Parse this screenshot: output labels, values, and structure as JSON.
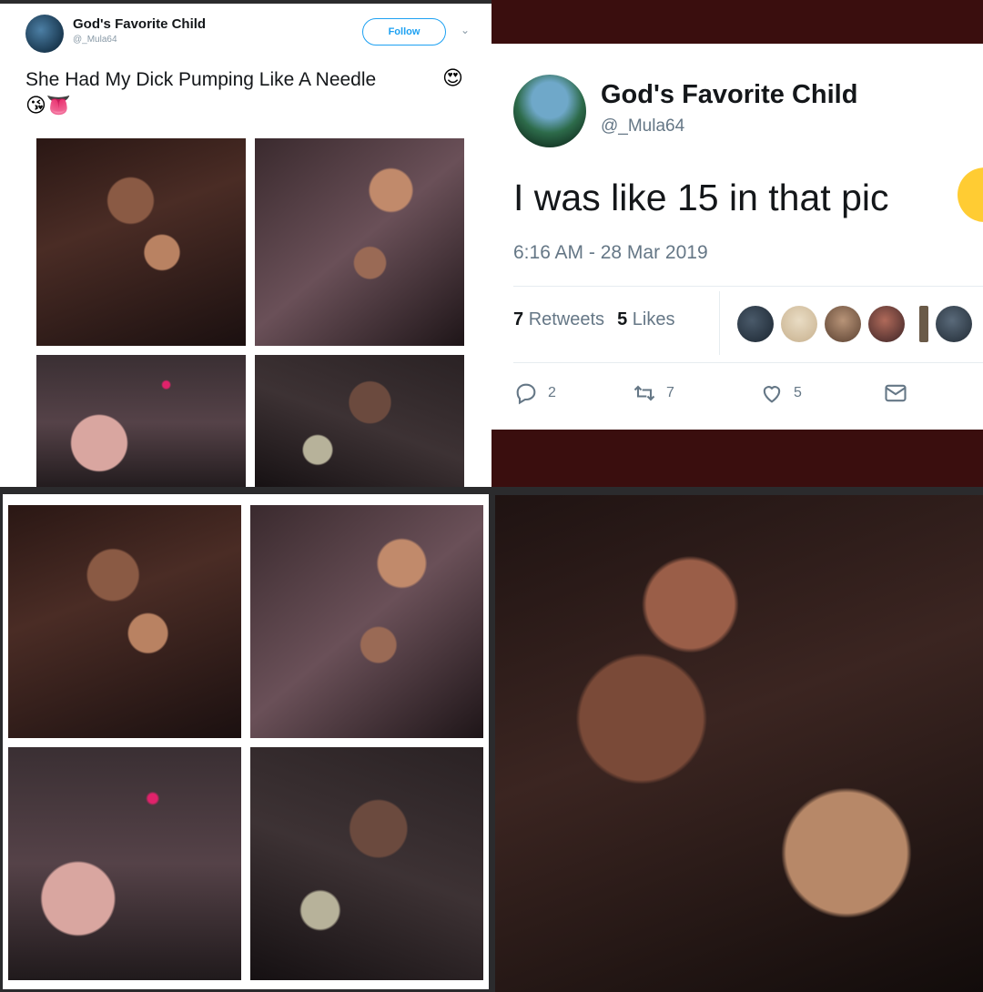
{
  "tweet1": {
    "name": "God's Favorite Child",
    "handle": "@_Mula64",
    "follow_label": "Follow",
    "caret": "⌄",
    "text": "She Had My Dick Pumping Like A Needle",
    "emoji_line1": "😍",
    "emoji_line2": "😘👅"
  },
  "tweet2": {
    "name": "God's Favorite Child",
    "handle": "@_Mula64",
    "text": "I was like 15 in that pic",
    "time": "6:16 AM - 28 Mar 2019",
    "retweets_count": "7",
    "retweets_label": "Retweets",
    "likes_count": "5",
    "likes_label": "Likes",
    "actions": {
      "reply_count": "2",
      "retweet_count": "7",
      "like_count": "5"
    }
  },
  "colors": {
    "twitter_blue": "#1da1f2",
    "text_dark": "#14171a",
    "text_gray": "#657786",
    "panel_maroon": "#3a0e0e",
    "page_background": "#2b2b2d"
  },
  "icons": [
    "reply-icon",
    "retweet-icon",
    "heart-icon",
    "message-icon",
    "chevron-down-icon"
  ]
}
